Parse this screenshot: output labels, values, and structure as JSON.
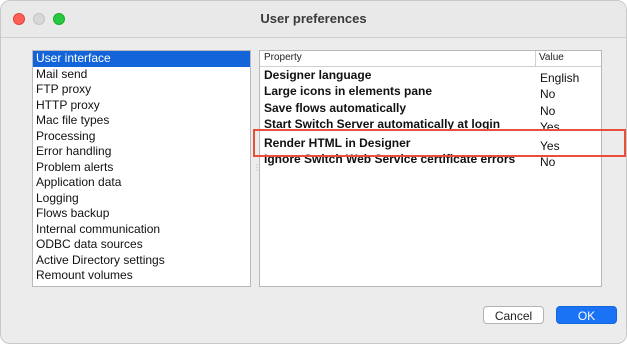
{
  "window": {
    "title": "User preferences"
  },
  "sidebar": {
    "items": [
      {
        "label": "User interface",
        "selected": true
      },
      {
        "label": "Mail send"
      },
      {
        "label": "FTP proxy"
      },
      {
        "label": "HTTP proxy"
      },
      {
        "label": "Mac file types"
      },
      {
        "label": "Processing"
      },
      {
        "label": "Error handling"
      },
      {
        "label": "Problem alerts"
      },
      {
        "label": "Application data"
      },
      {
        "label": "Logging"
      },
      {
        "label": "Flows backup"
      },
      {
        "label": "Internal communication"
      },
      {
        "label": "ODBC data sources"
      },
      {
        "label": "Active Directory settings"
      },
      {
        "label": "Remount volumes"
      }
    ]
  },
  "table": {
    "headers": {
      "property": "Property",
      "value": "Value"
    },
    "rows": [
      {
        "property": "Designer language",
        "value": "English"
      },
      {
        "property": "Large icons in elements pane",
        "value": "No"
      },
      {
        "property": "Save flows automatically",
        "value": "No"
      },
      {
        "property": "Start Switch Server automatically at login",
        "value": "Yes"
      },
      {
        "property": "Render HTML in Designer",
        "value": "Yes",
        "highlighted": true
      },
      {
        "property": "Ignore Switch Web Service certificate errors",
        "value": "No"
      }
    ]
  },
  "buttons": {
    "cancel": "Cancel",
    "ok": "OK"
  },
  "colors": {
    "selection": "#1464d9",
    "accent": "#1a73f5",
    "highlight_outline": "#e8503a"
  }
}
